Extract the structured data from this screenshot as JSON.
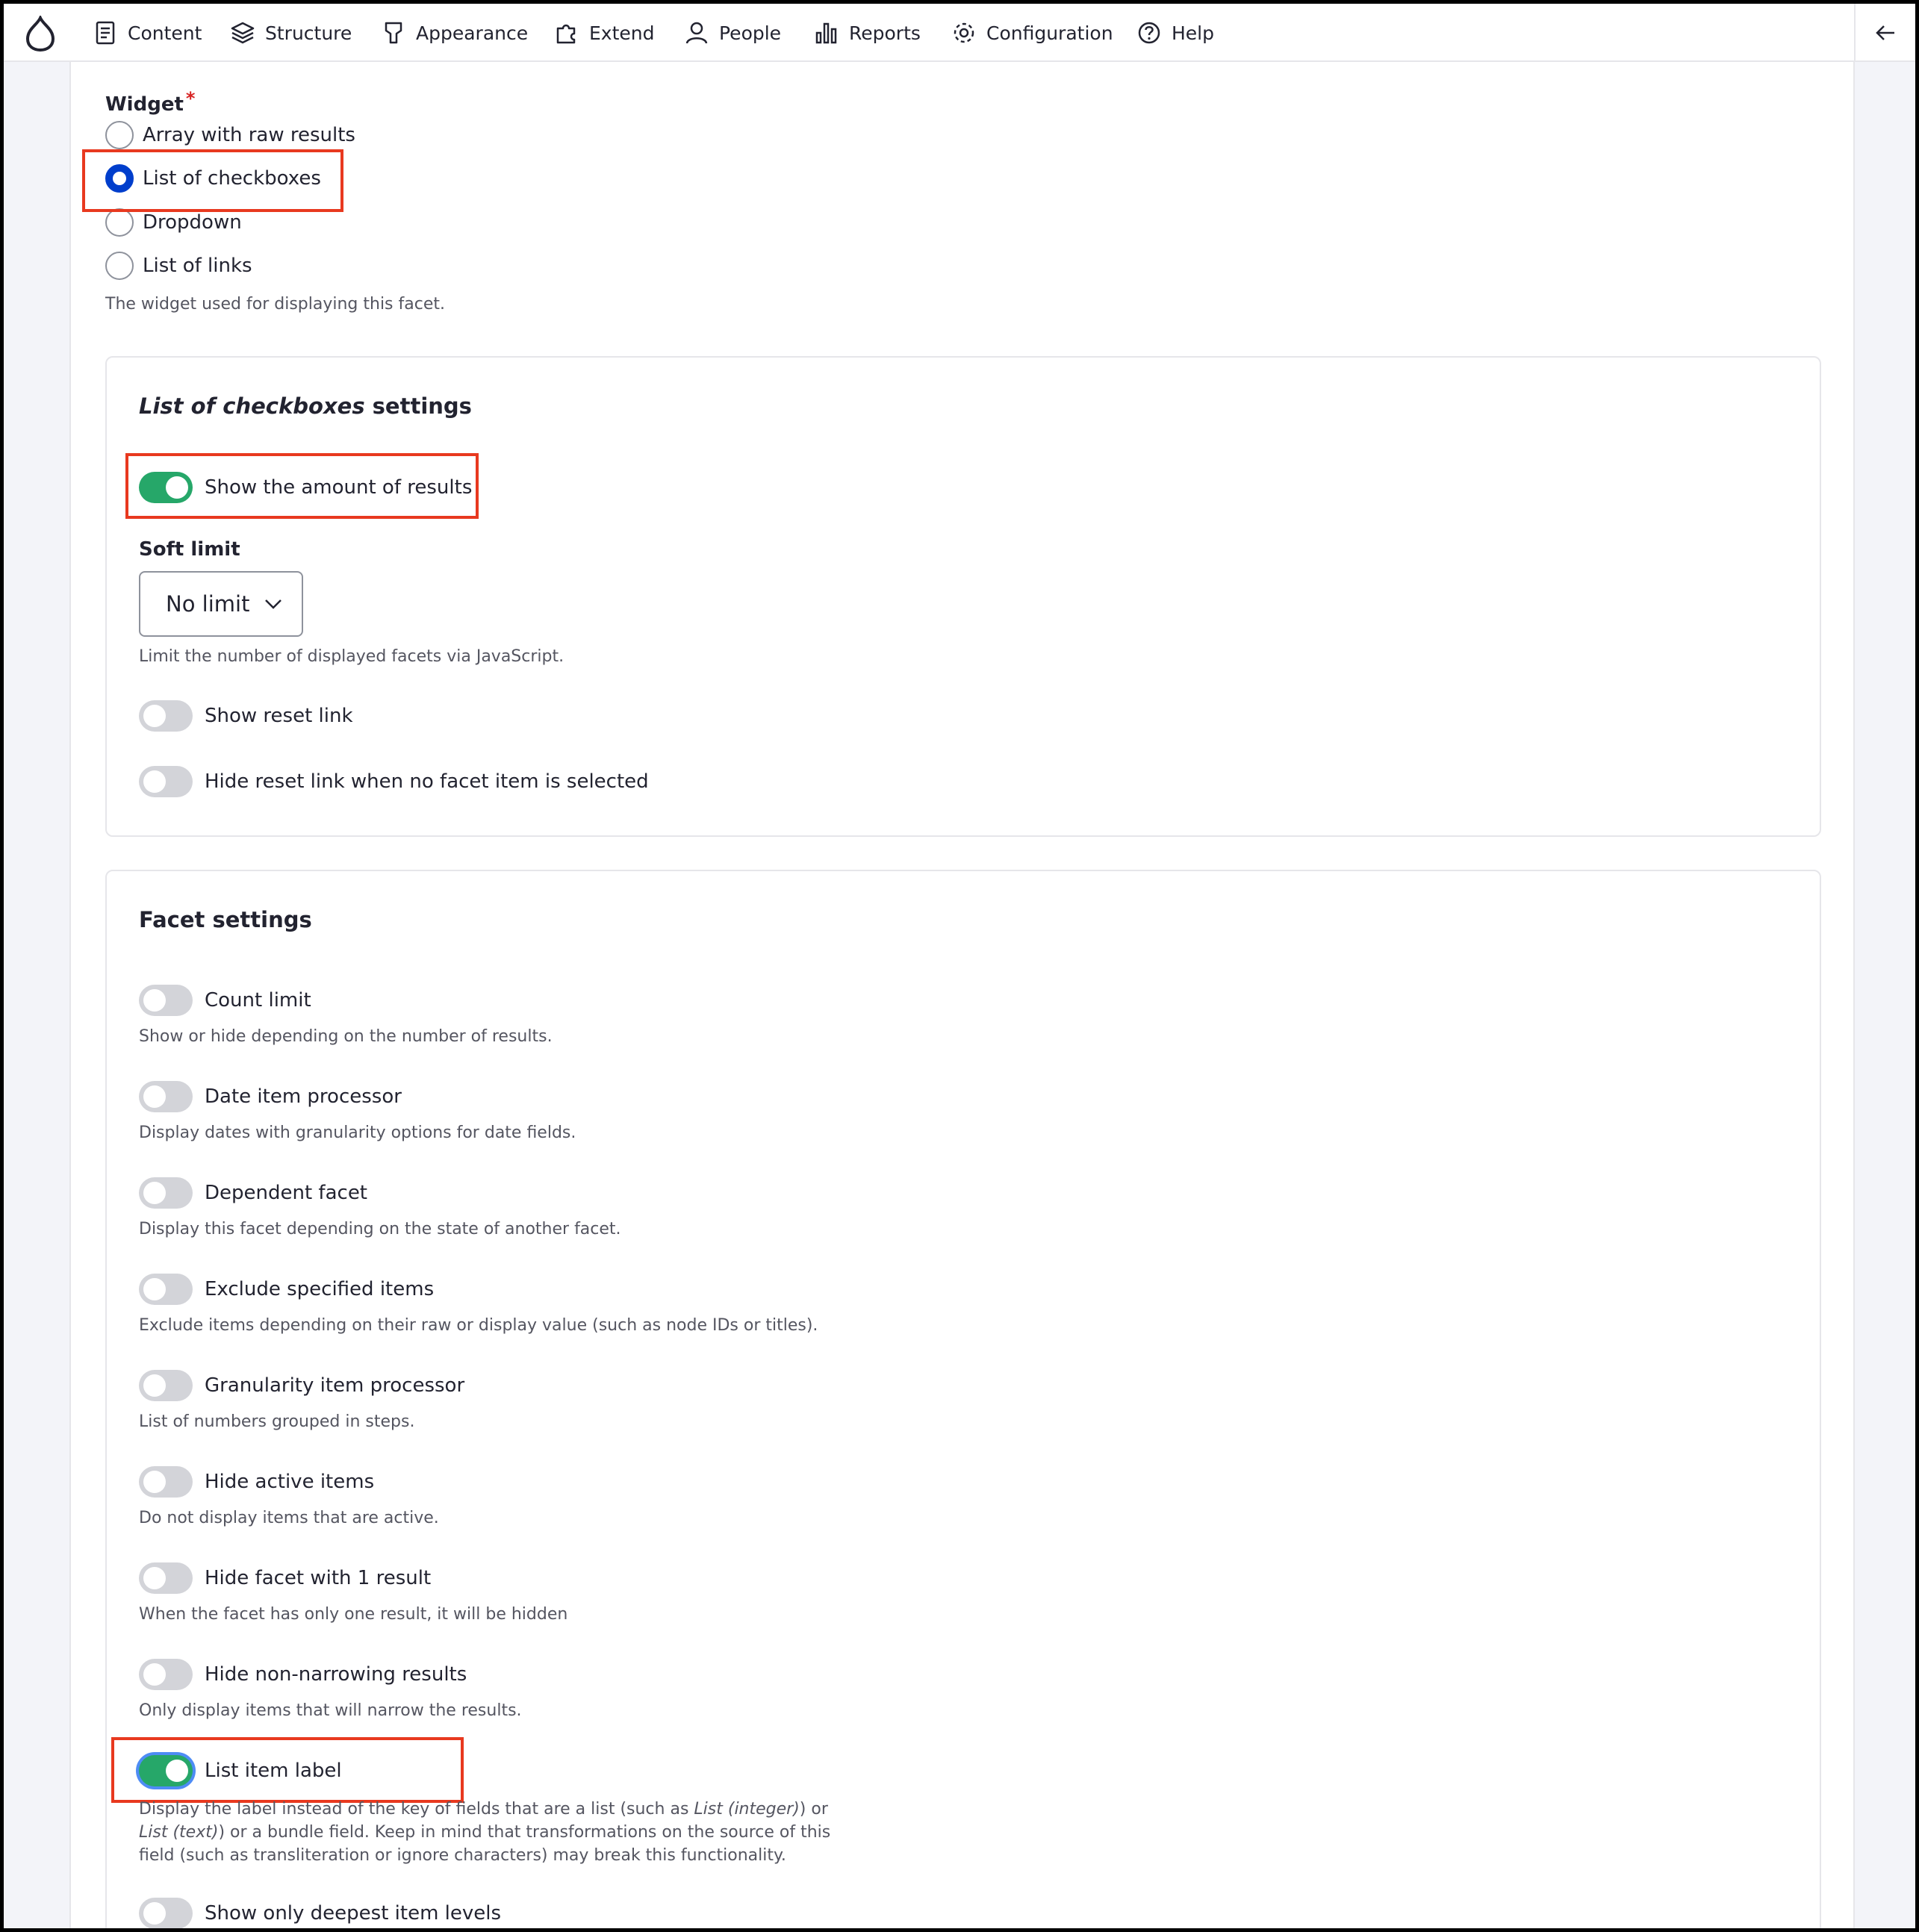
{
  "toolbar": {
    "items": [
      {
        "label": "Content",
        "icon": "content-icon"
      },
      {
        "label": "Structure",
        "icon": "structure-icon"
      },
      {
        "label": "Appearance",
        "icon": "appearance-icon"
      },
      {
        "label": "Extend",
        "icon": "extend-icon"
      },
      {
        "label": "People",
        "icon": "people-icon"
      },
      {
        "label": "Reports",
        "icon": "reports-icon"
      },
      {
        "label": "Configuration",
        "icon": "configuration-icon"
      },
      {
        "label": "Help",
        "icon": "help-icon"
      }
    ]
  },
  "widget": {
    "label": "Widget",
    "required_mark": "*",
    "options": [
      {
        "label": "Array with raw results",
        "checked": false
      },
      {
        "label": "List of checkboxes",
        "checked": true
      },
      {
        "label": "Dropdown",
        "checked": false
      },
      {
        "label": "List of links",
        "checked": false
      }
    ],
    "description": "The widget used for displaying this facet."
  },
  "checkbox_settings": {
    "title_em": "List of checkboxes",
    "title_rest": " settings",
    "show_amount": {
      "label": "Show the amount of results",
      "on": true
    },
    "soft_limit": {
      "label": "Soft limit",
      "value": "No limit",
      "description": "Limit the number of displayed facets via JavaScript."
    },
    "show_reset": {
      "label": "Show reset link",
      "on": false
    },
    "hide_reset": {
      "label": "Hide reset link when no facet item is selected",
      "on": false
    }
  },
  "facet_settings": {
    "title": "Facet settings",
    "items": [
      {
        "label": "Count limit",
        "description": "Show or hide depending on the number of results.",
        "on": false
      },
      {
        "label": "Date item processor",
        "description": "Display dates with granularity options for date fields.",
        "on": false
      },
      {
        "label": "Dependent facet",
        "description": "Display this facet depending on the state of another facet.",
        "on": false
      },
      {
        "label": "Exclude specified items",
        "description": "Exclude items depending on their raw or display value (such as node IDs or titles).",
        "on": false
      },
      {
        "label": "Granularity item processor",
        "description": "List of numbers grouped in steps.",
        "on": false
      },
      {
        "label": "Hide active items",
        "description": "Do not display items that are active.",
        "on": false
      },
      {
        "label": "Hide facet with 1 result",
        "description": "When the facet has only one result, it will be hidden",
        "on": false
      },
      {
        "label": "Hide non-narrowing results",
        "description": "Only display items that will narrow the results.",
        "on": false
      }
    ],
    "list_item_label": {
      "label": "List item label",
      "on": true,
      "desc_1": "Display the label instead of the key of fields that are a list (such as ",
      "desc_em1": "List (integer)",
      "desc_2": ") or",
      "desc_em2": "List (text)",
      "desc_3": ") or a bundle field. Keep in mind that transformations on the source of this",
      "desc_4": "field (such as transliteration or ignore characters) may break this functionality."
    },
    "deepest": {
      "label": "Show only deepest item levels",
      "on": false
    }
  },
  "colors": {
    "accent_blue": "#003ecc",
    "toggle_on": "#26a769",
    "highlight": "#e8391f"
  }
}
